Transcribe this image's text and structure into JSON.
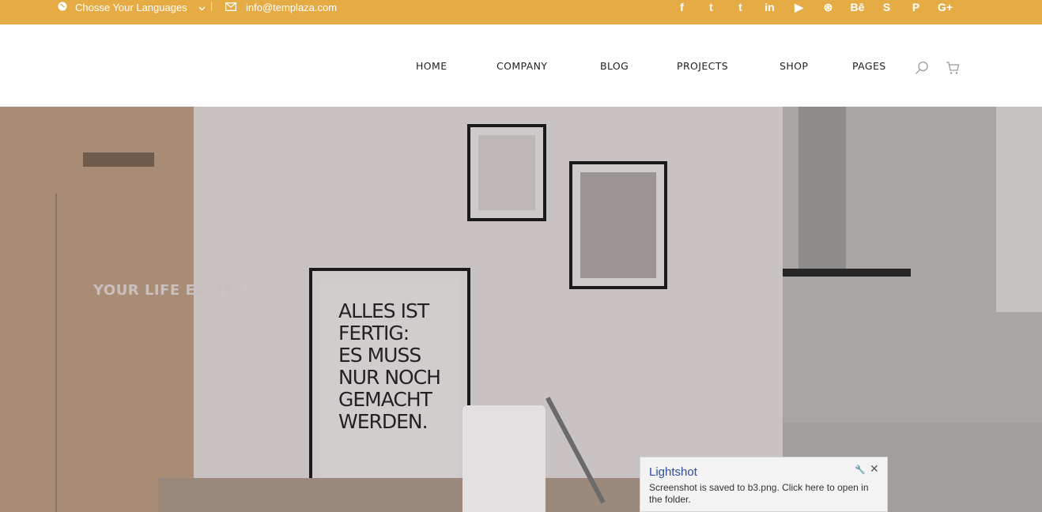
{
  "topbar": {
    "language_label": "Chosse Your Languages",
    "email": "info@templaza.com",
    "social": [
      "f",
      "t",
      "t",
      "in",
      "▶",
      "⊛",
      "Bē",
      "S",
      "P",
      "G+"
    ]
  },
  "nav": {
    "items": [
      "HOME",
      "COMPANY",
      "BLOG",
      "PROJECTS",
      "SHOP",
      "PAGES"
    ]
  },
  "hero": {
    "tagline": "YOUR LIFE EASIER",
    "poster_lines": [
      "ALLES IST",
      "FERTIG:",
      "ES MUSS",
      "NUR NOCH",
      "GEMACHT",
      "WERDEN."
    ]
  },
  "notification": {
    "title": "Lightshot",
    "message": "Screenshot is saved to b3.png. Click here to open in the folder."
  },
  "colors": {
    "topbar": "#e5ab45",
    "link_blue": "#2e4f9f"
  }
}
